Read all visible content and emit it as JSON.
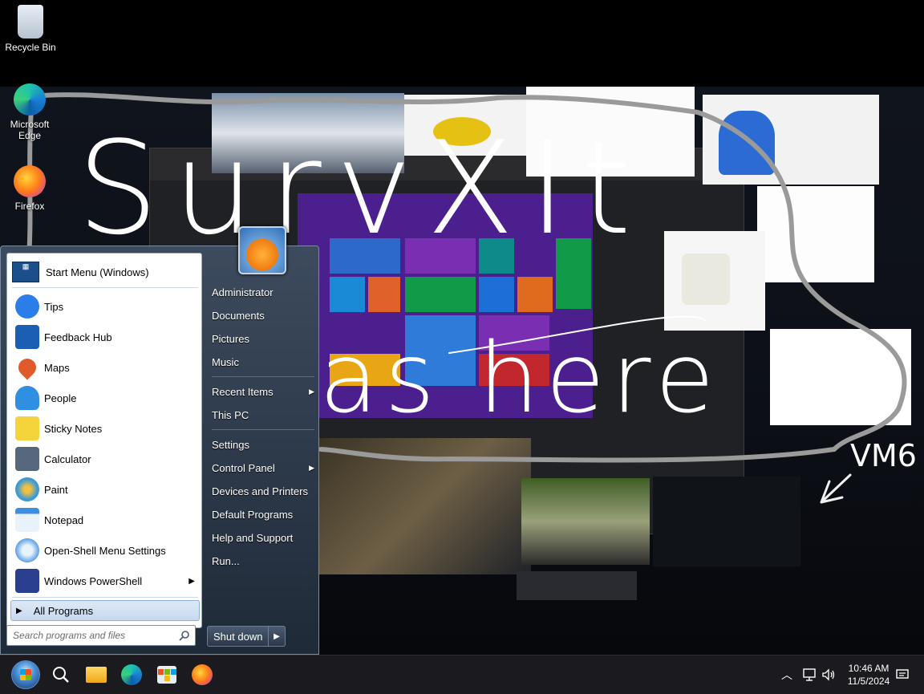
{
  "desktop": {
    "icons": [
      {
        "label": "Recycle Bin",
        "icon": "recycle-bin-icon"
      },
      {
        "label": "Microsoft Edge",
        "icon": "edge-icon"
      },
      {
        "label": "Firefox",
        "icon": "firefox-icon"
      }
    ],
    "scribble": {
      "line1": "SurvXIt",
      "line2": "as here",
      "tag": "VM6"
    }
  },
  "start_menu": {
    "pinned": {
      "label": "Start Menu (Windows)",
      "icon": "start-menu-icon"
    },
    "programs": [
      {
        "label": "Tips",
        "icon": "tips-icon",
        "color": "#2b7de9"
      },
      {
        "label": "Feedback Hub",
        "icon": "feedback-hub-icon",
        "color": "#1a5fb4"
      },
      {
        "label": "Maps",
        "icon": "maps-icon",
        "color": "#e05a2b"
      },
      {
        "label": "People",
        "icon": "people-icon",
        "color": "#2f8fe0"
      },
      {
        "label": "Sticky Notes",
        "icon": "sticky-notes-icon",
        "color": "#f5d33a"
      },
      {
        "label": "Calculator",
        "icon": "calculator-icon",
        "color": "#58687c"
      },
      {
        "label": "Paint",
        "icon": "paint-icon",
        "color": "#3a9ad9"
      },
      {
        "label": "Notepad",
        "icon": "notepad-icon",
        "color": "#3d8ee0"
      },
      {
        "label": "Open-Shell Menu Settings",
        "icon": "open-shell-icon",
        "color": "#5aa0e6"
      },
      {
        "label": "Windows PowerShell",
        "icon": "powershell-icon",
        "color": "#2a3f8f",
        "has_submenu": true
      }
    ],
    "all_programs": "All Programs",
    "search_placeholder": "Search programs and files",
    "right_items": [
      {
        "label": "Administrator"
      },
      {
        "label": "Documents"
      },
      {
        "label": "Pictures"
      },
      {
        "label": "Music"
      },
      {
        "label": "Recent Items",
        "has_submenu": true
      },
      {
        "label": "This PC"
      },
      {
        "label": "Settings"
      },
      {
        "label": "Control Panel",
        "has_submenu": true
      },
      {
        "label": "Devices and Printers"
      },
      {
        "label": "Default Programs"
      },
      {
        "label": "Help and Support"
      },
      {
        "label": "Run..."
      }
    ],
    "shutdown": "Shut down"
  },
  "taskbar": {
    "apps": [
      {
        "name": "start",
        "icon": "start-orb-icon"
      },
      {
        "name": "search",
        "icon": "search-icon"
      },
      {
        "name": "file-explorer",
        "icon": "folder-icon"
      },
      {
        "name": "edge",
        "icon": "edge-icon"
      },
      {
        "name": "store",
        "icon": "store-icon"
      },
      {
        "name": "firefox",
        "icon": "firefox-icon"
      }
    ],
    "time": "10:46 AM",
    "date": "11/5/2024"
  },
  "colors": {
    "accent": "#2b7de9",
    "start_menu_bg": "#2c3848",
    "taskbar_bg": "#1b1b1f"
  }
}
